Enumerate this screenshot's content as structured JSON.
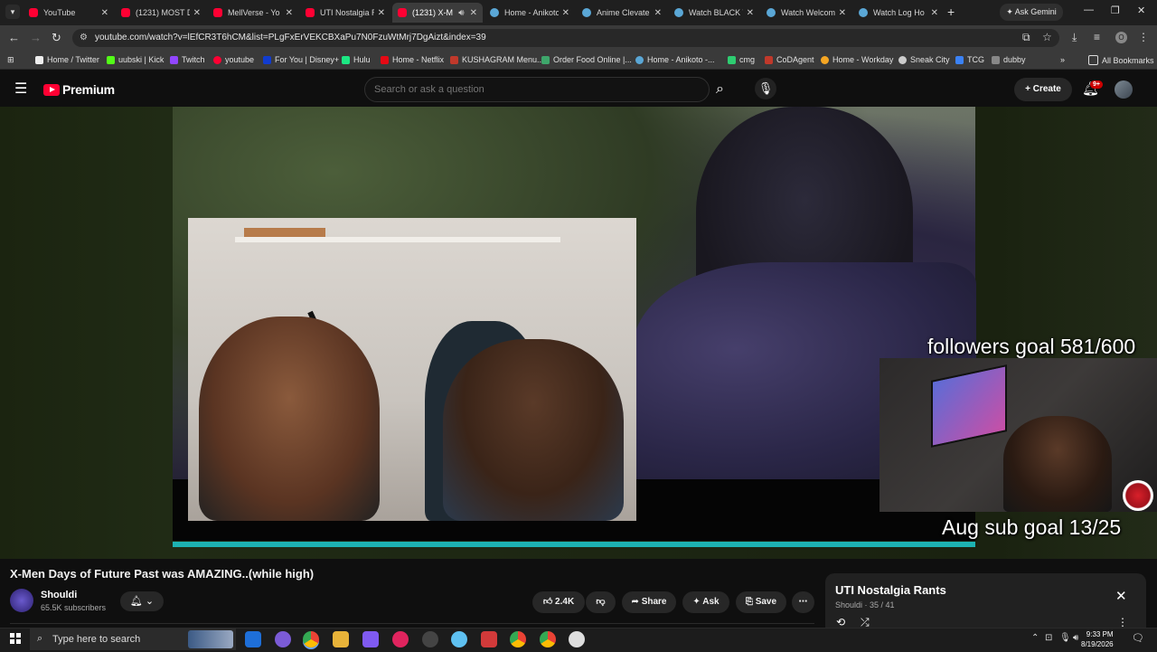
{
  "browser": {
    "tabs": [
      {
        "label": "YouTube",
        "icon": "youtube-icon"
      },
      {
        "label": "(1231) MOST D",
        "icon": "youtube-icon"
      },
      {
        "label": "MellVerse - Yo",
        "icon": "youtube-icon"
      },
      {
        "label": "UTI Nostalgia R",
        "icon": "youtube-icon"
      },
      {
        "label": "(1231) X-M",
        "icon": "youtube-icon"
      },
      {
        "label": "Home - Anikoto",
        "icon": "globe-icon"
      },
      {
        "label": "Anime Clevate",
        "icon": "globe-icon"
      },
      {
        "label": "Watch BLACK T",
        "icon": "globe-icon"
      },
      {
        "label": "Watch Welcom",
        "icon": "globe-icon"
      },
      {
        "label": "Watch Log Ho",
        "icon": "globe-icon"
      }
    ],
    "new_tab": "+",
    "ask_gemini": "Ask Gemini",
    "url": "youtube.com/watch?v=lEfCR3T6hCM&list=PLgFxErVEKCBXaPu7N0FzuWtMrj7DgAizt&index=39",
    "bookmarks": [
      {
        "label": "Home / Twitter",
        "color": "#ffffff"
      },
      {
        "label": "uubski | Kick",
        "color": "#53fc18"
      },
      {
        "label": "Twitch",
        "color": "#9146ff"
      },
      {
        "label": "youtube",
        "color": "#ff0033"
      },
      {
        "label": "For You | Disney+",
        "color": "#113ccf"
      },
      {
        "label": "Hulu",
        "color": "#1ce783"
      },
      {
        "label": "Home - Netflix",
        "color": "#e50914"
      },
      {
        "label": "KUSHAGRAM Menu...",
        "color": "#c0392b"
      },
      {
        "label": "Order Food Online |...",
        "color": "#3ea66b"
      },
      {
        "label": "Home - Anikoto -...",
        "color": "#5aa7d6"
      },
      {
        "label": "cmg",
        "color": "#2ecc71"
      },
      {
        "label": "CoDAgent",
        "color": "#c0392b"
      },
      {
        "label": "Home - Workday",
        "color": "#f5a623"
      },
      {
        "label": "Sneak City",
        "color": "#cccccc"
      },
      {
        "label": "TCG",
        "color": "#3b82f6"
      },
      {
        "label": "dubby",
        "color": "#888888"
      }
    ],
    "all_bookmarks": "All Bookmarks",
    "more_bookmarks": "»"
  },
  "youtube": {
    "brand": "Premium",
    "search_placeholder": "Search or ask a question",
    "create_label": "Create",
    "notification_badge": "9+"
  },
  "video": {
    "overlay_followers": "followers goal 581/600",
    "overlay_subs": "Aug sub goal 13/25",
    "progress_fraction": 1.0,
    "title": "X-Men Days of Future Past was AMAZING..(while high)",
    "channel": "Shouldi",
    "subscribers": "65.5K subscribers",
    "likes": "2.4K",
    "share_label": "Share",
    "ask_label": "Ask",
    "save_label": "Save"
  },
  "playlist": {
    "title": "UTI Nostalgia Rants",
    "meta": "Shouldi · 35 / 41"
  },
  "taskbar": {
    "search_placeholder": "Type here to search",
    "time": "9:33 PM",
    "date": "8/19/2026"
  }
}
